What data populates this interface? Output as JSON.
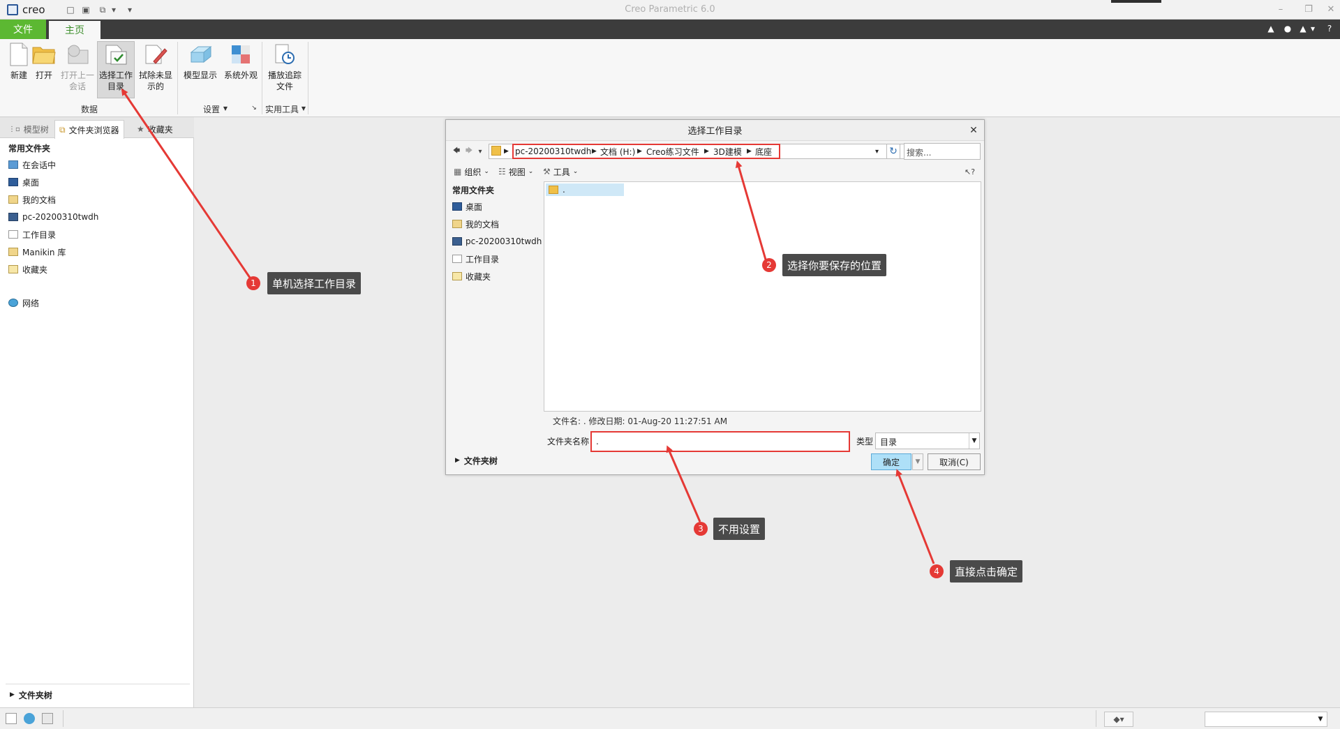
{
  "app": {
    "logo_text": "creo",
    "title": "Creo Parametric 6.0"
  },
  "menubar": {
    "file_tab": "文件",
    "home_tab": "主页"
  },
  "ribbon": {
    "buttons": {
      "new": "新建",
      "open": "打开",
      "open_last_line1": "打开上一",
      "open_last_line2": "会话",
      "select_dir_line1": "选择工作",
      "select_dir_line2": "目录",
      "erase_line1": "拭除未显",
      "erase_line2": "示的",
      "model_display": "模型显示",
      "system_appearance": "系统外观",
      "playback_line1": "播放追踪",
      "playback_line2": "文件"
    },
    "groups": {
      "data": "数据",
      "settings": "设置",
      "utilities": "实用工具"
    }
  },
  "left_panel": {
    "tabs": {
      "model_tree": "模型树",
      "folder_browser": "文件夹浏览器",
      "favorites": "收藏夹"
    },
    "section_common": "常用文件夹",
    "items": [
      "在会话中",
      "桌面",
      "我的文档",
      "pc-20200310twdh",
      "工作目录",
      "Manikin 库",
      "收藏夹"
    ],
    "network": "网络",
    "folder_tree": "文件夹树"
  },
  "dialog": {
    "title": "选择工作目录",
    "breadcrumbs": [
      "pc-20200310twdh",
      "文档 (H:)",
      "Creo练习文件",
      "3D建模",
      "底座"
    ],
    "search_placeholder": "搜索...",
    "toolbar": {
      "organize": "组织",
      "view": "视图",
      "tools": "工具"
    },
    "side_header": "常用文件夹",
    "side_items": [
      "桌面",
      "我的文档",
      "pc-20200310twdh",
      "工作目录",
      "收藏夹"
    ],
    "file_item": ".",
    "file_info": "文件名: . 修改日期: 01-Aug-20 11:27:51 AM",
    "folder_name_label": "文件夹名称",
    "folder_name_value": ".",
    "type_label": "类型",
    "type_value": "目录",
    "ok": "确定",
    "cancel": "取消(C)",
    "folder_tree": "文件夹树"
  },
  "annotations": [
    {
      "num": "1",
      "text": "单机选择工作目录"
    },
    {
      "num": "2",
      "text": "选择你要保存的位置"
    },
    {
      "num": "3",
      "text": "不用设置"
    },
    {
      "num": "4",
      "text": "直接点击确定"
    }
  ],
  "colors": {
    "accent_green": "#5cb832",
    "menubar_dark": "#3c3c3c",
    "annotation_red": "#e53935",
    "callout_bg": "#4a4a4a",
    "ok_button": "#aee0f8"
  }
}
